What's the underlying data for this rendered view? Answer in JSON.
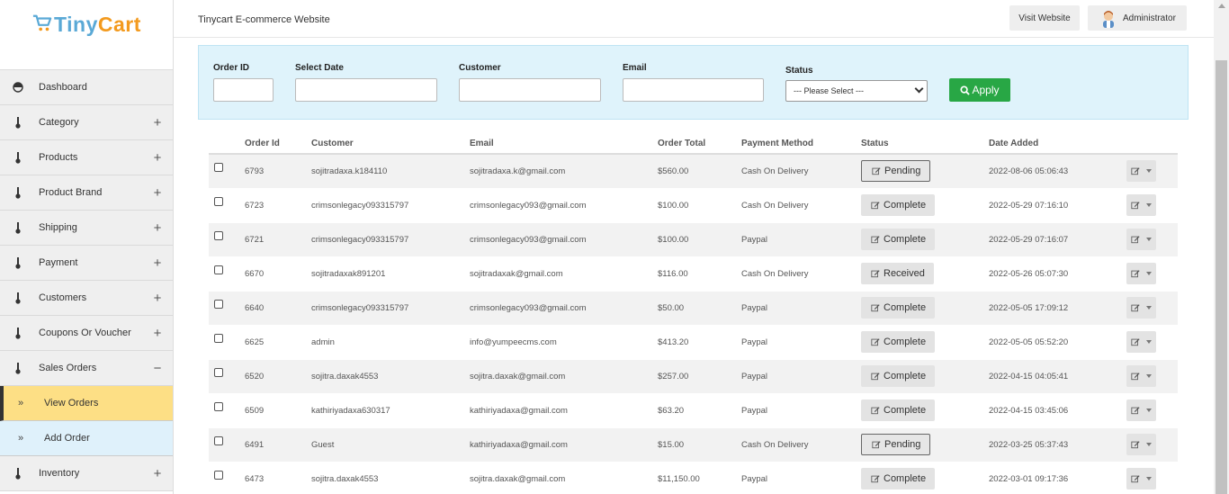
{
  "brand": {
    "tiny": "Tiny",
    "cart": "Cart"
  },
  "header": {
    "title": "Tinycart E-commerce Website",
    "visit_label": "Visit Website",
    "admin_label": "Administrator"
  },
  "sidebar": {
    "items": [
      {
        "label": "Dashboard",
        "icon": "dashboard-icon",
        "toggle": ""
      },
      {
        "label": "Category",
        "icon": "thermometer-icon",
        "toggle": "+"
      },
      {
        "label": "Products",
        "icon": "thermometer-icon",
        "toggle": "+"
      },
      {
        "label": "Product Brand",
        "icon": "thermometer-icon",
        "toggle": "+"
      },
      {
        "label": "Shipping",
        "icon": "thermometer-icon",
        "toggle": "+"
      },
      {
        "label": "Payment",
        "icon": "thermometer-icon",
        "toggle": "+"
      },
      {
        "label": "Customers",
        "icon": "thermometer-icon",
        "toggle": "+"
      },
      {
        "label": "Coupons Or Voucher",
        "icon": "thermometer-icon",
        "toggle": "+"
      },
      {
        "label": "Sales Orders",
        "icon": "thermometer-icon",
        "toggle": "−"
      }
    ],
    "sub_items": [
      {
        "label": "View Orders",
        "icon": "double-chevron-icon",
        "active": true
      },
      {
        "label": "Add Order",
        "icon": "double-chevron-icon",
        "active": false
      }
    ],
    "after": {
      "label": "Inventory",
      "icon": "thermometer-icon",
      "toggle": "+"
    }
  },
  "filter": {
    "order_id_label": "Order ID",
    "date_label": "Select Date",
    "customer_label": "Customer",
    "email_label": "Email",
    "status_label": "Status",
    "order_id_value": "",
    "date_value": "",
    "customer_value": "",
    "email_value": "",
    "status_selected": "--- Please Select ---",
    "apply_label": "Apply"
  },
  "table": {
    "headers": [
      "Order Id",
      "Customer",
      "Email",
      "Order Total",
      "Payment Method",
      "Status",
      "Date Added"
    ],
    "rows": [
      {
        "id": "6793",
        "customer": "sojitradaxa.k184110",
        "email": "sojitradaxa.k@gmail.com",
        "total": "$560.00",
        "payment": "Cash On Delivery",
        "status": "Pending",
        "date": "2022-08-06 05:06:43"
      },
      {
        "id": "6723",
        "customer": "crimsonlegacy093315797",
        "email": "crimsonlegacy093@gmail.com",
        "total": "$100.00",
        "payment": "Cash On Delivery",
        "status": "Complete",
        "date": "2022-05-29 07:16:10"
      },
      {
        "id": "6721",
        "customer": "crimsonlegacy093315797",
        "email": "crimsonlegacy093@gmail.com",
        "total": "$100.00",
        "payment": "Paypal",
        "status": "Complete",
        "date": "2022-05-29 07:16:07"
      },
      {
        "id": "6670",
        "customer": "sojitradaxak891201",
        "email": "sojitradaxak@gmail.com",
        "total": "$116.00",
        "payment": "Cash On Delivery",
        "status": "Received",
        "date": "2022-05-26 05:07:30"
      },
      {
        "id": "6640",
        "customer": "crimsonlegacy093315797",
        "email": "crimsonlegacy093@gmail.com",
        "total": "$50.00",
        "payment": "Paypal",
        "status": "Complete",
        "date": "2022-05-05 17:09:12"
      },
      {
        "id": "6625",
        "customer": "admin",
        "email": "info@yumpeecms.com",
        "total": "$413.20",
        "payment": "Paypal",
        "status": "Complete",
        "date": "2022-05-05 05:52:20"
      },
      {
        "id": "6520",
        "customer": "sojitra.daxak4553",
        "email": "sojitra.daxak@gmail.com",
        "total": "$257.00",
        "payment": "Paypal",
        "status": "Complete",
        "date": "2022-04-15 04:05:41"
      },
      {
        "id": "6509",
        "customer": "kathiriyadaxa630317",
        "email": "kathiriyadaxa@gmail.com",
        "total": "$63.20",
        "payment": "Paypal",
        "status": "Complete",
        "date": "2022-04-15 03:45:06"
      },
      {
        "id": "6491",
        "customer": "Guest",
        "email": "kathiriyadaxa@gmail.com",
        "total": "$15.00",
        "payment": "Cash On Delivery",
        "status": "Pending",
        "date": "2022-03-25 05:37:43"
      },
      {
        "id": "6473",
        "customer": "sojitra.daxak4553",
        "email": "sojitra.daxak@gmail.com",
        "total": "$11,150.00",
        "payment": "Paypal",
        "status": "Complete",
        "date": "2022-03-01 09:17:36"
      }
    ]
  },
  "colors": {
    "apply": "#28a745",
    "filter_bg": "#dff3fb",
    "active_nav": "#fddf85",
    "sub_nav": "#dff1fb",
    "brand_blue": "#5aa9d6",
    "brand_orange": "#f39a1e"
  }
}
